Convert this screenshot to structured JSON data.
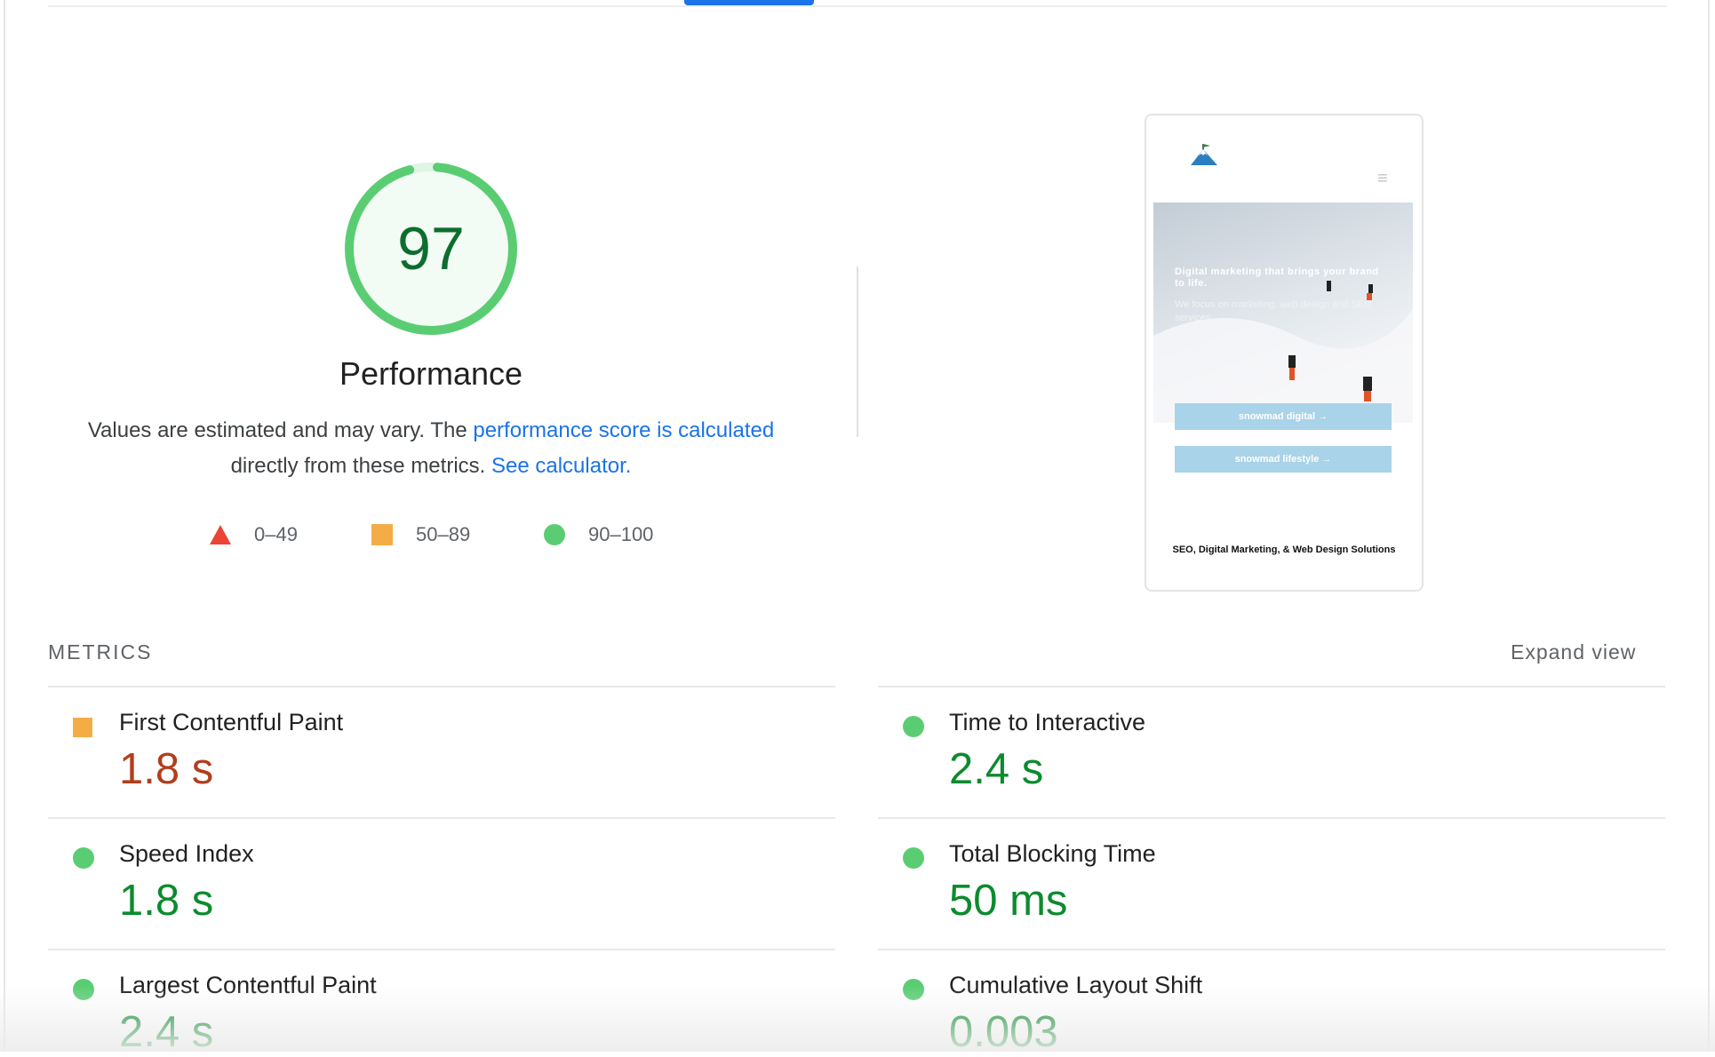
{
  "gauge": {
    "score": "97",
    "label": "Performance",
    "value_fraction": 0.97,
    "color": "#5acd73"
  },
  "description": {
    "text_before": "Values are estimated and may vary. The ",
    "link1": "performance score is calculated",
    "text_middle": " directly from these metrics. ",
    "link2": "See calculator."
  },
  "legend": [
    {
      "icon": "triangle",
      "range": "0–49",
      "color": "#eb4336"
    },
    {
      "icon": "square",
      "range": "50–89",
      "color": "#f4ac47"
    },
    {
      "icon": "circle",
      "range": "90–100",
      "color": "#5acd73"
    }
  ],
  "preview": {
    "headline": "Digital marketing that brings your brand to life.",
    "subtext": "We focus on marketing, web design and SEO services",
    "button1": "snowmad digital →",
    "button2": "snowmad lifestyle →",
    "footer": "SEO, Digital Marketing, & Web Design Solutions"
  },
  "metrics": {
    "title": "METRICS",
    "expand_label": "Expand view",
    "items": [
      {
        "label": "First Contentful Paint",
        "value": "1.8 s",
        "status": "average"
      },
      {
        "label": "Time to Interactive",
        "value": "2.4 s",
        "status": "pass"
      },
      {
        "label": "Speed Index",
        "value": "1.8 s",
        "status": "pass"
      },
      {
        "label": "Total Blocking Time",
        "value": "50 ms",
        "status": "pass"
      },
      {
        "label": "Largest Contentful Paint",
        "value": "2.4 s",
        "status": "pass"
      },
      {
        "label": "Cumulative Layout Shift",
        "value": "0.003",
        "status": "pass"
      }
    ]
  }
}
